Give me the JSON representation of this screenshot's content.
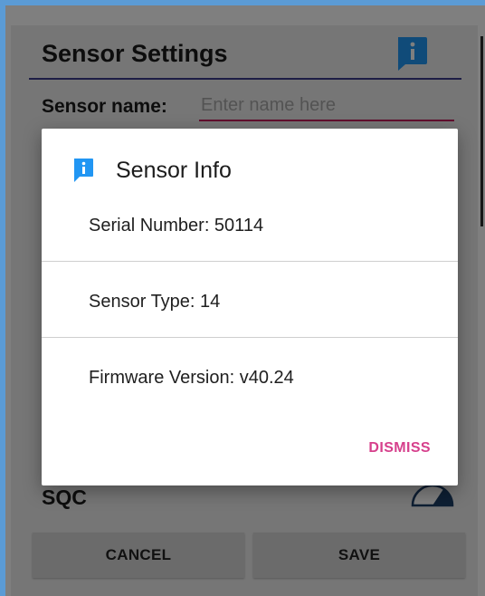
{
  "settings": {
    "title": "Sensor Settings",
    "info_icon": "info-icon",
    "name_label": "Sensor name:",
    "name_value": "",
    "name_placeholder": "Enter name here",
    "sqc_label": "SQC",
    "sqc_icon": "gauge-icon",
    "cancel_label": "CANCEL",
    "save_label": "SAVE"
  },
  "dialog": {
    "title": "Sensor Info",
    "icon": "info-icon",
    "serial_number": "Serial Number: 50114",
    "sensor_type": "Sensor Type: 14",
    "firmware_version": "Firmware Version: v40.24",
    "dismiss_label": "DISMISS"
  },
  "colors": {
    "accent_blue": "#2196f3",
    "dismiss_pink": "#d6408c",
    "input_underline": "#c2185b",
    "header_underline": "#3c3c8c"
  }
}
